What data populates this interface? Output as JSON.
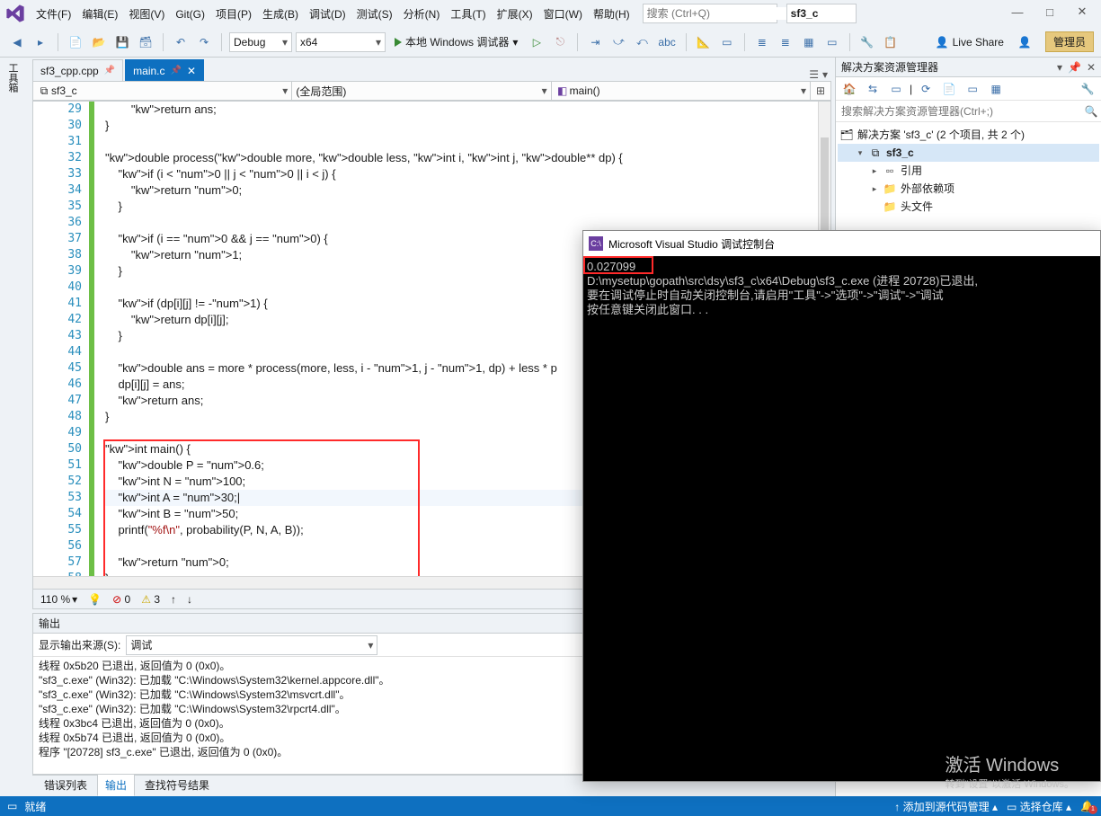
{
  "menu": {
    "items": [
      "文件(F)",
      "编辑(E)",
      "视图(V)",
      "Git(G)",
      "项目(P)",
      "生成(B)",
      "调试(D)",
      "测试(S)",
      "分析(N)",
      "工具(T)",
      "扩展(X)",
      "窗口(W)",
      "帮助(H)"
    ],
    "search_placeholder": "搜索 (Ctrl+Q)",
    "project_name": "sf3_c"
  },
  "window_buttons": {
    "min": "—",
    "max": "□",
    "close": "✕"
  },
  "toolbar": {
    "config": "Debug",
    "platform": "x64",
    "run_label": "本地 Windows 调试器",
    "live_share": "Live Share",
    "admin": "管理员"
  },
  "left_rail": "工具箱",
  "tabs": [
    {
      "name": "sf3_cpp.cpp",
      "pinned": true,
      "active": false
    },
    {
      "name": "main.c",
      "pinned": true,
      "active": true
    }
  ],
  "navbar": {
    "scope1": "sf3_c",
    "scope2": "(全局范围)",
    "scope3": "main()"
  },
  "code": {
    "first_line": 29,
    "lines": [
      "        return ans;",
      "}",
      "",
      "double process(double more, double less, int i, int j, double** dp) {",
      "    if (i < 0 || j < 0 || i < j) {",
      "        return 0;",
      "    }",
      "",
      "    if (i == 0 && j == 0) {",
      "        return 1;",
      "    }",
      "",
      "    if (dp[i][j] != -1) {",
      "        return dp[i][j];",
      "    }",
      "",
      "    double ans = more * process(more, less, i - 1, j - 1, dp) + less * p",
      "    dp[i][j] = ans;",
      "    return ans;",
      "}",
      "",
      "int main() {",
      "    double P = 0.6;",
      "    int N = 100;",
      "    int A = 30;|",
      "    int B = 50;",
      "    printf(\"%f\\n\", probability(P, N, A, B));",
      "",
      "    return 0;",
      "}"
    ],
    "highlight_index": 24
  },
  "editor_status": {
    "zoom": "110 %",
    "errors": "0",
    "warnings": "3"
  },
  "output": {
    "title": "输出",
    "source_label": "显示输出来源(S):",
    "source_value": "调试",
    "lines": [
      "线程 0x5b20 已退出, 返回值为 0 (0x0)。",
      "\"sf3_c.exe\" (Win32): 已加载 \"C:\\Windows\\System32\\kernel.appcore.dll\"。",
      "\"sf3_c.exe\" (Win32): 已加载 \"C:\\Windows\\System32\\msvcrt.dll\"。",
      "\"sf3_c.exe\" (Win32): 已加载 \"C:\\Windows\\System32\\rpcrt4.dll\"。",
      "线程 0x3bc4 已退出, 返回值为 0 (0x0)。",
      "线程 0x5b74 已退出, 返回值为 0 (0x0)。",
      "程序 \"[20728] sf3_c.exe\" 已退出, 返回值为 0 (0x0)。"
    ]
  },
  "tooltabs": [
    "错误列表",
    "输出",
    "查找符号结果"
  ],
  "tooltab_active": 1,
  "solution": {
    "title": "解决方案资源管理器",
    "search_placeholder": "搜索解决方案资源管理器(Ctrl+;)",
    "root": "解决方案 'sf3_c' (2 个项目, 共 2 个)",
    "nodes": [
      {
        "label": "sf3_c",
        "bold": true,
        "sel": true,
        "depth": 1,
        "twist": "▾",
        "icon": "⧉"
      },
      {
        "label": "引用",
        "depth": 2,
        "twist": "▸",
        "icon": "▫▫"
      },
      {
        "label": "外部依赖项",
        "depth": 2,
        "twist": "▸",
        "icon": "📁"
      },
      {
        "label": "头文件",
        "depth": 2,
        "twist": "",
        "icon": "📁"
      }
    ]
  },
  "status": {
    "ready": "就绪",
    "add_src": "添加到源代码管理",
    "select_repo": "选择仓库",
    "notif": "1"
  },
  "console": {
    "title": "Microsoft Visual Studio 调试控制台",
    "result": "0.027099",
    "lines": [
      "",
      "D:\\mysetup\\gopath\\src\\dsy\\sf3_c\\x64\\Debug\\sf3_c.exe (进程 20728)已退出,",
      "要在调试停止时自动关闭控制台,请启用\"工具\"->\"选项\"->\"调试\"->\"调试",
      "按任意键关闭此窗口. . ."
    ]
  },
  "watermark": {
    "big": "激活 Windows",
    "small": "转到\"设置\"以激活 Windows。"
  }
}
